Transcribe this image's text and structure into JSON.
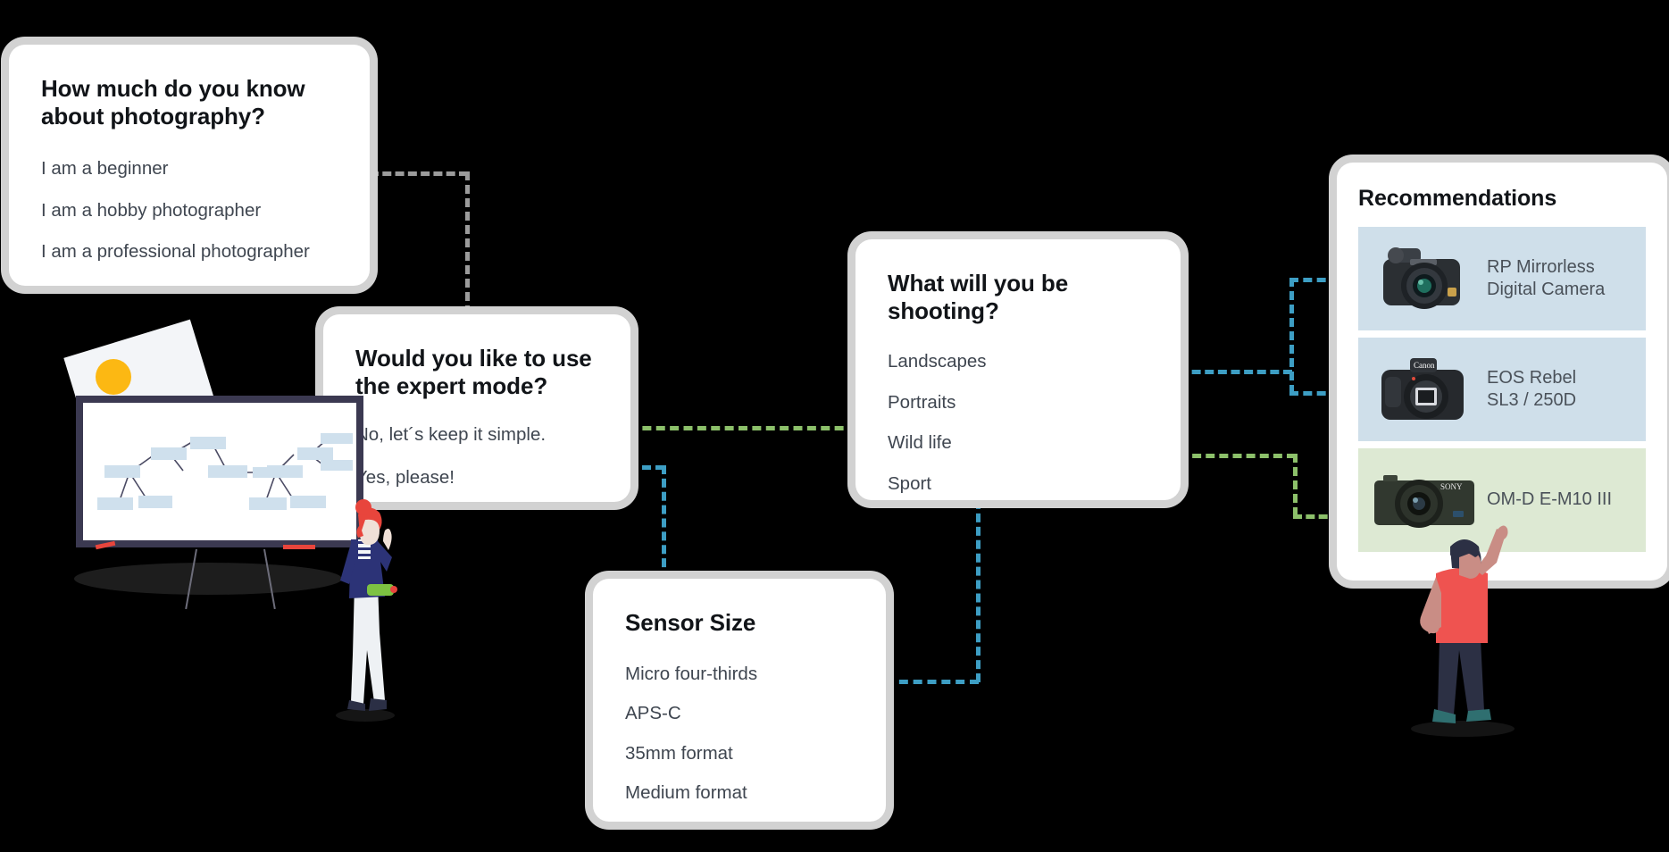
{
  "theme": {
    "background": "#000000",
    "card_bg": "#ffffff",
    "card_border": "#d2d2d2",
    "heading_color": "#111418",
    "option_color": "#3f4650",
    "connector_grey": "#9b9b9b",
    "connector_blue": "#3d9ec4",
    "connector_green": "#8cc06a",
    "rec_blue_bg": "#cfdfea",
    "rec_green_bg": "#dde9d3",
    "accent_yellow": "#fcb813",
    "accent_red": "#ef5350",
    "board_frame": "#3b3951",
    "node_fill": "#cfe0ed"
  },
  "cards": {
    "knowledge": {
      "title": "How much do you know about photography?",
      "options": [
        "I am a beginner",
        "I am a hobby photographer",
        "I am a professional photographer"
      ]
    },
    "expert": {
      "title": "Would you like to use the expert mode?",
      "options": [
        "No, let´s keep it simple.",
        "Yes, please!"
      ]
    },
    "shooting": {
      "title": "What will you be shooting?",
      "options": [
        "Landscapes",
        "Portraits",
        "Wild life",
        "Sport"
      ]
    },
    "sensor": {
      "title": "Sensor Size",
      "options": [
        "Micro four-thirds",
        "APS-C",
        "35mm format",
        "Medium format"
      ]
    },
    "recommendations": {
      "title": "Recommendations",
      "items": [
        {
          "label": "RP Mirrorless\nDigital Camera",
          "tone": "blue",
          "icon": "bridge-camera-icon"
        },
        {
          "label": "EOS Rebel\nSL3 / 250D",
          "tone": "blue",
          "icon": "dslr-camera-icon"
        },
        {
          "label": "OM-D E-M10 III",
          "tone": "green",
          "icon": "compact-camera-icon"
        }
      ]
    }
  },
  "illustration": {
    "left": "woman-presenting-at-whiteboard",
    "right": "man-pointing-at-recommendations"
  }
}
